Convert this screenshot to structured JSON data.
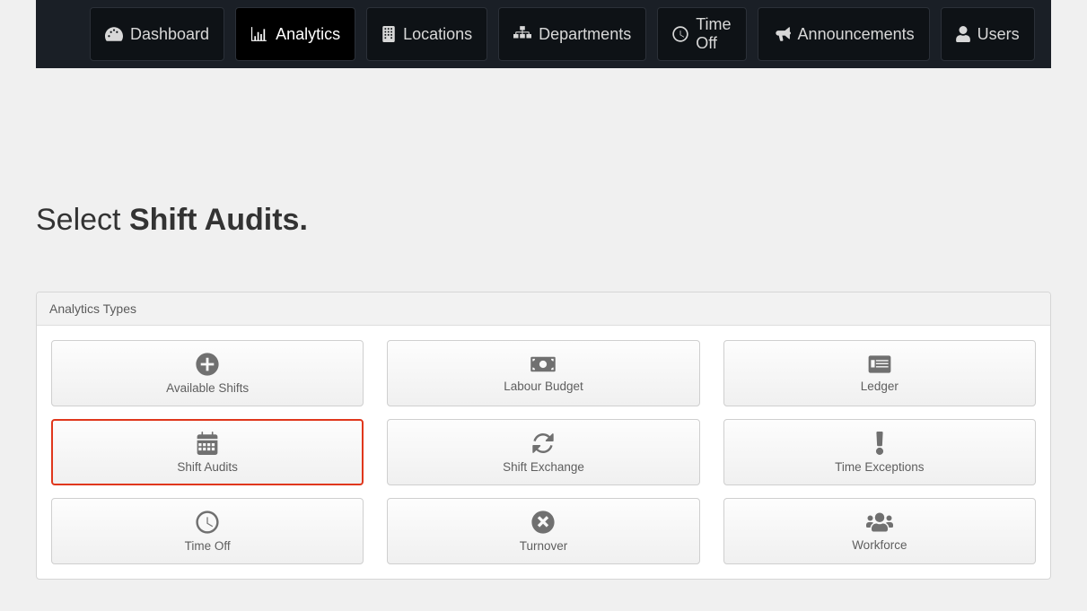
{
  "nav": {
    "items": [
      {
        "label": "Dashboard",
        "icon": "dashboard-icon",
        "active": false
      },
      {
        "label": "Analytics",
        "icon": "barchart-icon",
        "active": true
      },
      {
        "label": "Locations",
        "icon": "building-icon",
        "active": false
      },
      {
        "label": "Departments",
        "icon": "sitemap-icon",
        "active": false
      },
      {
        "label": "Time Off",
        "icon": "clock-icon",
        "active": false
      },
      {
        "label": "Announcements",
        "icon": "bullhorn-icon",
        "active": false
      },
      {
        "label": "Users",
        "icon": "user-icon",
        "active": false
      }
    ]
  },
  "instruction": {
    "prefix": "Select ",
    "bold": "Shift Audits."
  },
  "panel": {
    "title": "Analytics Types",
    "cards": [
      {
        "label": "Available Shifts",
        "icon": "plus-circle-icon",
        "highlight": false
      },
      {
        "label": "Labour Budget",
        "icon": "money-bill-icon",
        "highlight": false
      },
      {
        "label": "Ledger",
        "icon": "list-card-icon",
        "highlight": false
      },
      {
        "label": "Shift Audits",
        "icon": "calendar-icon",
        "highlight": true
      },
      {
        "label": "Shift Exchange",
        "icon": "sync-icon",
        "highlight": false
      },
      {
        "label": "Time Exceptions",
        "icon": "exclamation-icon",
        "highlight": false
      },
      {
        "label": "Time Off",
        "icon": "clock-icon",
        "highlight": false
      },
      {
        "label": "Turnover",
        "icon": "times-circle-icon",
        "highlight": false
      },
      {
        "label": "Workforce",
        "icon": "users-icon",
        "highlight": false
      }
    ]
  }
}
